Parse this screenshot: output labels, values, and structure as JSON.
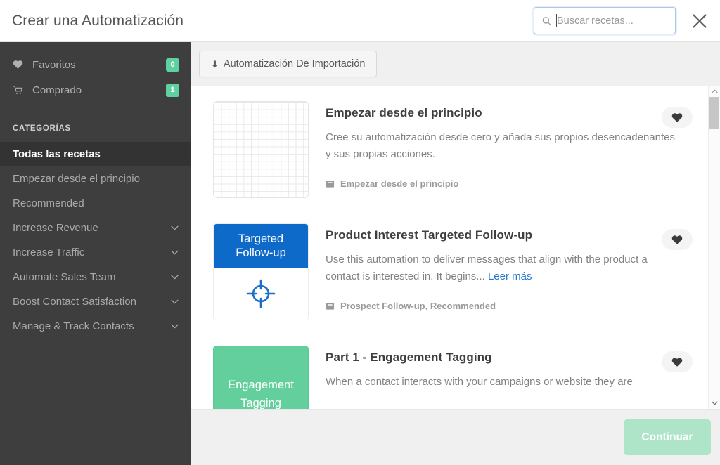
{
  "header": {
    "title": "Crear una Automatización",
    "search": {
      "placeholder": "Buscar recetas...",
      "value": "",
      "icon": "search-icon"
    },
    "close_icon": "close-icon"
  },
  "sidebar": {
    "top_items": [
      {
        "label": "Favoritos",
        "badge": "0",
        "icon": "heart-icon"
      },
      {
        "label": "Comprado",
        "badge": "1",
        "icon": "cart-icon"
      }
    ],
    "categories_header": "CATEGORÍAS",
    "categories": [
      {
        "label": "Todas las recetas",
        "active": true,
        "expandable": false
      },
      {
        "label": "Empezar desde el principio",
        "active": false,
        "expandable": false
      },
      {
        "label": "Recommended",
        "active": false,
        "expandable": false
      },
      {
        "label": "Increase Revenue",
        "active": false,
        "expandable": true
      },
      {
        "label": "Increase Traffic",
        "active": false,
        "expandable": true
      },
      {
        "label": "Automate Sales Team",
        "active": false,
        "expandable": true
      },
      {
        "label": "Boost Contact Satisfaction",
        "active": false,
        "expandable": true
      },
      {
        "label": "Manage & Track Contacts",
        "active": false,
        "expandable": true
      }
    ],
    "colors": {
      "background": "#3e3e3e",
      "active_background": "#333333",
      "badge": "#5fd0a0"
    }
  },
  "toolbar": {
    "import_label": "Automatización De Importación",
    "import_icon": "download-arrow-icon"
  },
  "recipes": [
    {
      "title": "Empezar desde el principio",
      "description": "Cree su automatización desde cero y añada sus propios desencadenantes y sus propias acciones.",
      "read_more": "",
      "tags": "Empezar desde el principio",
      "thumb_type": "grid",
      "thumb_line1": "",
      "thumb_line2": "",
      "favorite_icon": "heart-icon"
    },
    {
      "title": "Product Interest Targeted Follow-up",
      "description": "Use this automation to deliver messages that align with the product a contact is interested in. It begins...",
      "read_more": "Leer más",
      "tags": "Prospect Follow-up, Recommended",
      "thumb_type": "targeted",
      "thumb_line1": "Targeted",
      "thumb_line2": "Follow-up",
      "thumb_color": "#0d6ac8",
      "favorite_icon": "heart-icon"
    },
    {
      "title": "Part 1 - Engagement Tagging",
      "description": "When a contact interacts with your campaigns or website they are",
      "read_more": "",
      "tags": "",
      "thumb_type": "green",
      "thumb_line1": "Engagement",
      "thumb_line2": "Tagging",
      "thumb_color": "#63cf9d",
      "favorite_icon": "heart-icon"
    }
  ],
  "footer": {
    "continue_label": "Continuar",
    "continue_disabled": true,
    "continue_color": "#aee4c8"
  }
}
